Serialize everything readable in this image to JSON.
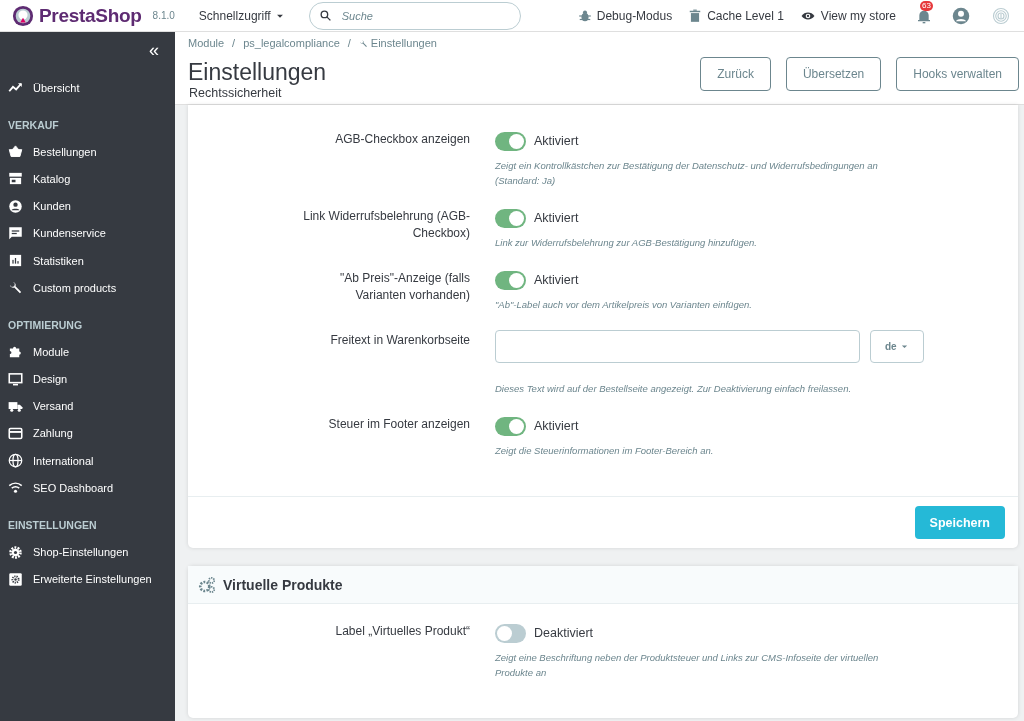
{
  "header": {
    "logo": "PrestaShop",
    "version": "8.1.0",
    "quick_access": "Schnellzugriff",
    "search": {
      "placeholder": "Suche"
    },
    "debug": "Debug-Modus",
    "cache": "Cache Level 1",
    "view_store": "View my store",
    "notifications": "63"
  },
  "sidebar": {
    "collapse": "«",
    "top_items": [
      "Übersicht"
    ],
    "sections": [
      {
        "title": "VERKAUF",
        "items": [
          "Bestellungen",
          "Katalog",
          "Kunden",
          "Kundenservice",
          "Statistiken",
          "Custom products"
        ]
      },
      {
        "title": "OPTIMIERUNG",
        "items": [
          "Module",
          "Design",
          "Versand",
          "Zahlung",
          "International",
          "SEO Dashboard"
        ]
      },
      {
        "title": "EINSTELLUNGEN",
        "items": [
          "Shop-Einstellungen",
          "Erweiterte Einstellungen"
        ]
      }
    ]
  },
  "page_header": {
    "breadcrumb_separator": "/",
    "breadcrumb": [
      "Module",
      "ps_legalcompliance",
      "Einstellungen"
    ],
    "title": "Einstellungen",
    "subtitle": "Rechtssicherheit",
    "buttons": [
      "Zurück",
      "Übersetzen",
      "Hooks verwalten"
    ]
  },
  "panels": [
    {
      "rows": [
        {
          "kind": "switch",
          "label": "AGB-Checkbox anzeigen",
          "on": true,
          "status": "Aktiviert",
          "hint": "Zeigt ein Kontrollkästchen zur Bestätigung der Datenschutz- und Widerrufsbedingungen an (Standard: Ja)"
        },
        {
          "kind": "switch",
          "label": "Link Widerrufsbelehrung (AGB-Checkbox)",
          "on": true,
          "status": "Aktiviert",
          "hint": "Link zur Widerrufsbelehrung zur AGB-Bestätigung hinzufügen."
        },
        {
          "kind": "switch",
          "label": "\"Ab Preis\"-Anzeige (falls Varianten vorhanden)",
          "on": true,
          "status": "Aktiviert",
          "hint": "\"Ab\"-Label auch vor dem Artikelpreis von Varianten einfügen."
        },
        {
          "kind": "text",
          "label": "Freitext in Warenkorbseite",
          "language": "de",
          "hint": "Dieses Text wird auf der Bestellseite angezeigt. Zur Deaktivierung einfach freilassen."
        },
        {
          "kind": "switch",
          "label": "Steuer im Footer anzeigen",
          "on": true,
          "status": "Aktiviert",
          "hint": "Zeigt die Steuerinformationen im Footer-Bereich an."
        }
      ],
      "footer_button": "Speichern"
    },
    {
      "title": "Virtuelle Produkte",
      "rows": [
        {
          "kind": "switch",
          "label": "Label „Virtuelles Produkt“",
          "on": false,
          "status": "Deaktiviert",
          "hint": "Zeigt eine Beschriftung neben der Produktsteuer und Links zur CMS-Infoseite der virtuellen Produkte an"
        }
      ]
    }
  ]
}
